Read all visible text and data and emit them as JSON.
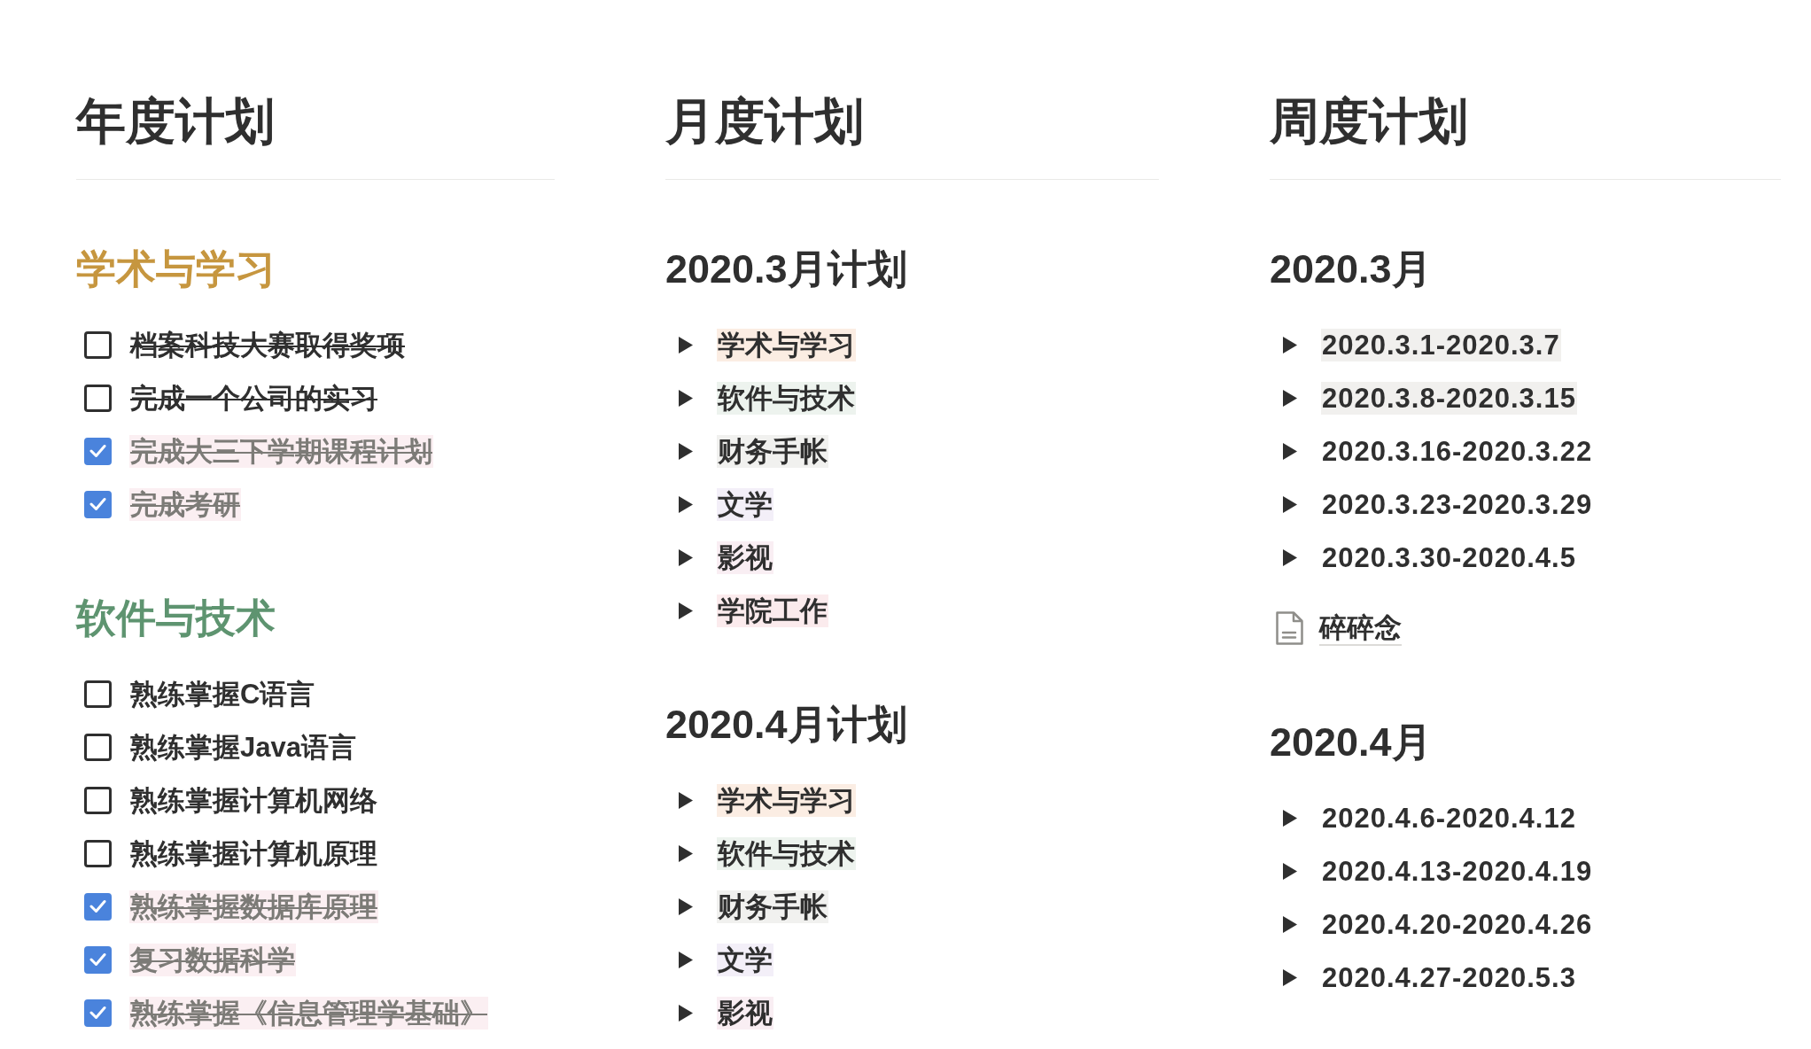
{
  "columns": [
    {
      "title": "年度计划",
      "sections": [
        {
          "heading": "学术与学习",
          "color": "#c6963f",
          "items": [
            {
              "kind": "todo",
              "text": "档案科技大赛取得奖项",
              "checked": false,
              "struck": true
            },
            {
              "kind": "todo",
              "text": "完成一个公司的实习",
              "checked": false,
              "struck": true
            },
            {
              "kind": "todo",
              "text": "完成大三下学期课程计划",
              "checked": true,
              "struck": true
            },
            {
              "kind": "todo",
              "text": "完成考研",
              "checked": true,
              "struck": true
            }
          ]
        },
        {
          "heading": "软件与技术",
          "color": "#5e9470",
          "items": [
            {
              "kind": "todo",
              "text": "熟练掌握C语言",
              "checked": false,
              "struck": false
            },
            {
              "kind": "todo",
              "text": "熟练掌握Java语言",
              "checked": false,
              "struck": false
            },
            {
              "kind": "todo",
              "text": "熟练掌握计算机网络",
              "checked": false,
              "struck": false
            },
            {
              "kind": "todo",
              "text": "熟练掌握计算机原理",
              "checked": false,
              "struck": false
            },
            {
              "kind": "todo",
              "text": "熟练掌握数据库原理",
              "checked": true,
              "struck": true
            },
            {
              "kind": "todo",
              "text": "复习数据科学",
              "checked": true,
              "struck": true
            },
            {
              "kind": "todo",
              "text": "熟练掌握《信息管理学基础》",
              "checked": true,
              "struck": true
            }
          ]
        }
      ]
    },
    {
      "title": "月度计划",
      "sections": [
        {
          "heading": "2020.3月计划",
          "items": [
            {
              "kind": "toggle",
              "text": "学术与学习",
              "expanded": false,
              "color": "#fbede3"
            },
            {
              "kind": "toggle",
              "text": "软件与技术",
              "expanded": false,
              "color": "#edf3ee"
            },
            {
              "kind": "toggle",
              "text": "财务手帐",
              "expanded": false,
              "color": "#f1f1ef"
            },
            {
              "kind": "toggle",
              "text": "文学",
              "expanded": false,
              "color": "#f3eff8"
            },
            {
              "kind": "toggle",
              "text": "影视",
              "expanded": false,
              "color": "#f9eef3"
            },
            {
              "kind": "toggle",
              "text": "学院工作",
              "expanded": false,
              "color": "#fbebed"
            }
          ]
        },
        {
          "heading": "2020.4月计划",
          "items": [
            {
              "kind": "toggle",
              "text": "学术与学习",
              "expanded": false,
              "color": "#fbede3"
            },
            {
              "kind": "toggle",
              "text": "软件与技术",
              "expanded": false,
              "color": "#edf3ee"
            },
            {
              "kind": "toggle",
              "text": "财务手帐",
              "expanded": false,
              "color": "#f1f1ef"
            },
            {
              "kind": "toggle",
              "text": "文学",
              "expanded": false,
              "color": "#f3eff8"
            },
            {
              "kind": "toggle",
              "text": "影视",
              "expanded": false,
              "color": "#f9eef3"
            }
          ]
        }
      ]
    },
    {
      "title": "周度计划",
      "sections": [
        {
          "heading": "2020.3月",
          "items": [
            {
              "kind": "toggle",
              "text": "2020.3.1-2020.3.7",
              "expanded": false,
              "color": "#f1f0ee"
            },
            {
              "kind": "toggle",
              "text": "2020.3.8-2020.3.15",
              "expanded": false,
              "color": "#f1f0ee"
            },
            {
              "kind": "toggle",
              "text": "2020.3.16-2020.3.22",
              "expanded": false
            },
            {
              "kind": "toggle",
              "text": "2020.3.23-2020.3.29",
              "expanded": false
            },
            {
              "kind": "toggle",
              "text": "2020.3.30-2020.4.5",
              "expanded": false
            },
            {
              "kind": "page",
              "text": "碎碎念"
            }
          ]
        },
        {
          "heading": "2020.4月",
          "items": [
            {
              "kind": "toggle",
              "text": "2020.4.6-2020.4.12",
              "expanded": false
            },
            {
              "kind": "toggle",
              "text": "2020.4.13-2020.4.19",
              "expanded": false
            },
            {
              "kind": "toggle",
              "text": "2020.4.20-2020.4.26",
              "expanded": false
            },
            {
              "kind": "toggle",
              "text": "2020.4.27-2020.5.3",
              "expanded": false
            }
          ]
        }
      ]
    }
  ]
}
